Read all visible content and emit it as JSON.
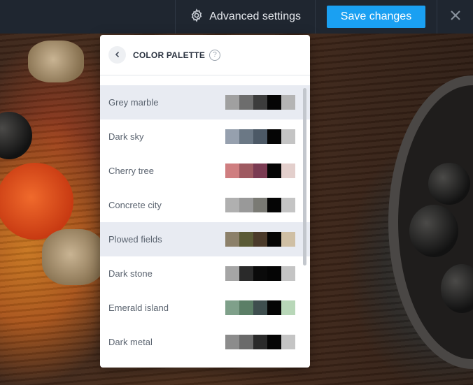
{
  "toolbar": {
    "advanced_label": "Advanced settings",
    "save_label": "Save changes",
    "close_icon": "close-icon",
    "settings_icon": "gear-icon",
    "accent": "#1aa0f2"
  },
  "panel": {
    "title": "COLOR PALETTE",
    "help": "?",
    "back_icon": "chevron-left-icon",
    "palettes": [
      {
        "name": "Grey marble",
        "selected": true,
        "colors": [
          "#a0a0a0",
          "#6d6d6d",
          "#3c3c3c",
          "#050505",
          "#b4b4b4"
        ]
      },
      {
        "name": "Dark sky",
        "selected": false,
        "colors": [
          "#96a0ae",
          "#6b7885",
          "#4c5966",
          "#050505",
          "#c4c4c4"
        ]
      },
      {
        "name": "Cherry tree",
        "selected": false,
        "colors": [
          "#cf7e80",
          "#9e5a61",
          "#7a3b52",
          "#050505",
          "#e3cfcc"
        ]
      },
      {
        "name": "Concrete city",
        "selected": false,
        "colors": [
          "#b0b0b0",
          "#999999",
          "#7a7a74",
          "#050505",
          "#c4c4c4"
        ]
      },
      {
        "name": "Plowed fields",
        "selected": true,
        "colors": [
          "#8c806a",
          "#5a5a36",
          "#4a3a2a",
          "#050505",
          "#cfbfa4"
        ]
      },
      {
        "name": "Dark stone",
        "selected": false,
        "colors": [
          "#a5a5a5",
          "#2a2a2a",
          "#0a0a0a",
          "#050505",
          "#c4c4c4"
        ]
      },
      {
        "name": "Emerald island",
        "selected": false,
        "colors": [
          "#7fa08a",
          "#5b7e66",
          "#3e4e4e",
          "#050505",
          "#b8d7b8"
        ]
      },
      {
        "name": "Dark metal",
        "selected": false,
        "colors": [
          "#8c8c8c",
          "#6a6a6a",
          "#2a2a2a",
          "#050505",
          "#c4c4c4"
        ]
      }
    ]
  }
}
